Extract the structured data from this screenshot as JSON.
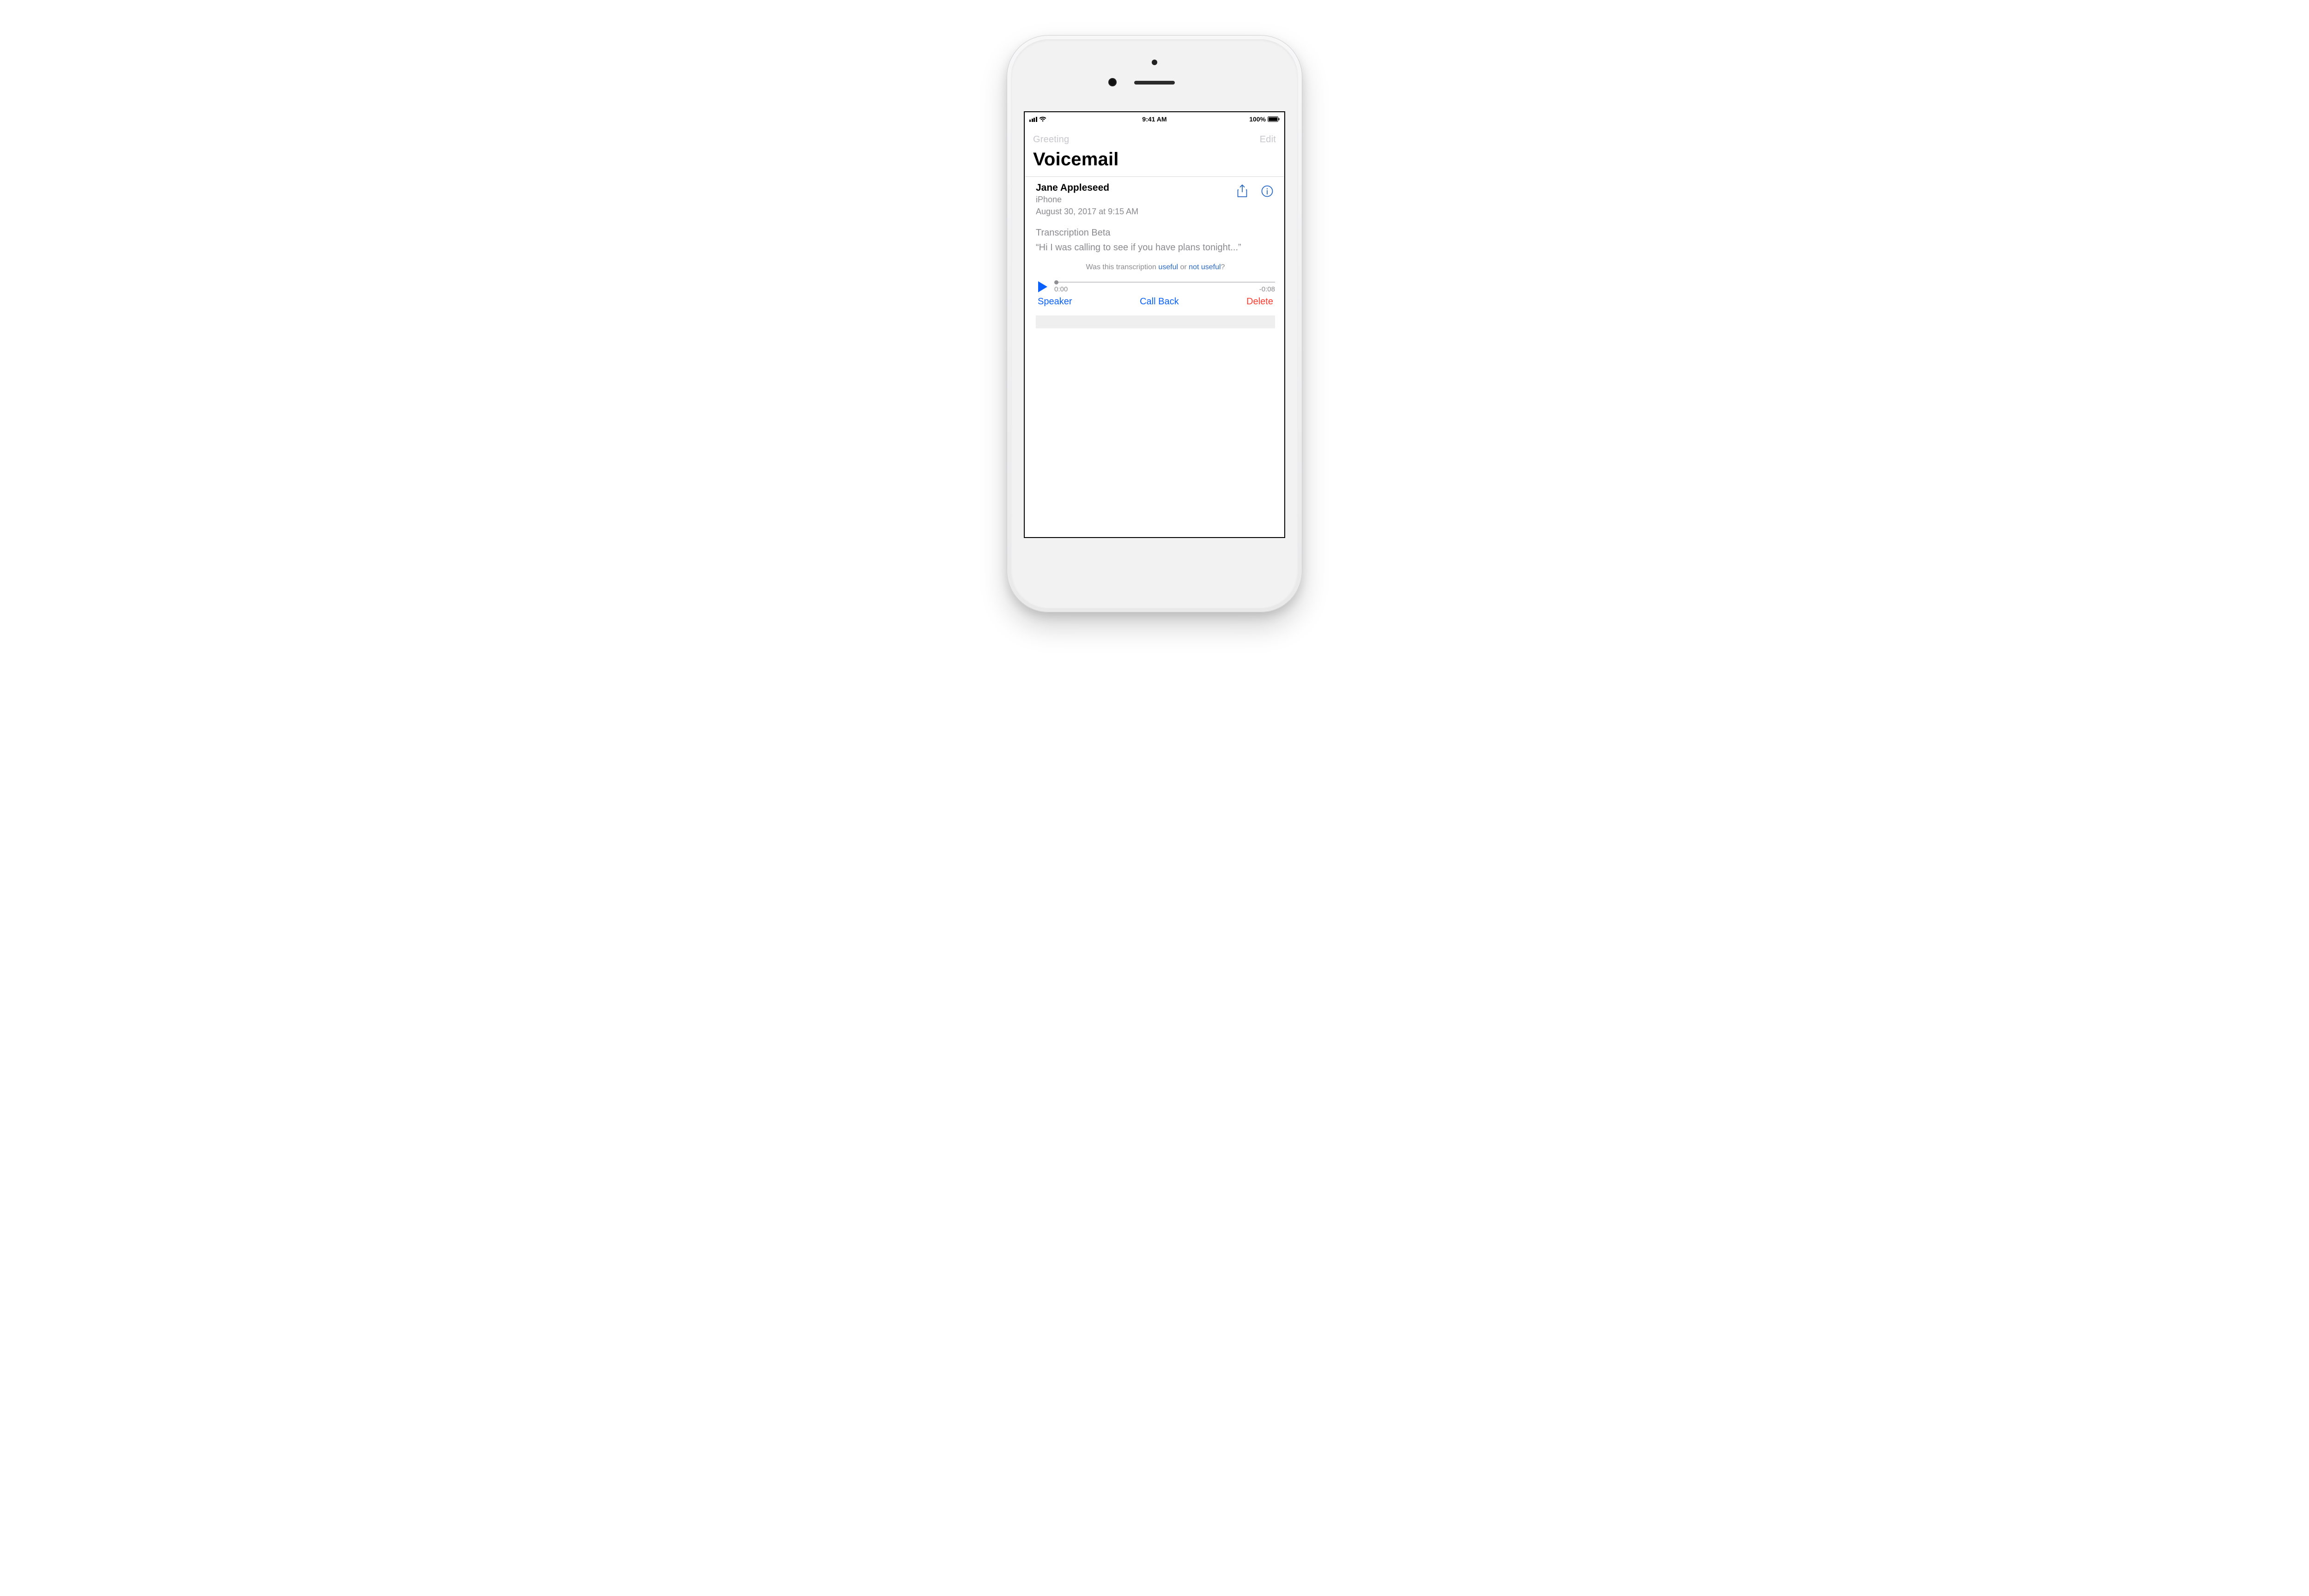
{
  "status": {
    "time": "9:41 AM",
    "battery": "100%"
  },
  "nav": {
    "greeting": "Greeting",
    "edit": "Edit"
  },
  "title": "Voicemail",
  "voicemail": {
    "caller": "Jane Appleseed",
    "source": "iPhone",
    "datetime": "August 30, 2017 at 9:15 AM",
    "transcription_label": "Transcription Beta",
    "transcription_text": "“Hi I was calling to see if you have plans tonight...”",
    "feedback_prefix": "Was this transcription ",
    "feedback_useful": "useful",
    "feedback_or": " or ",
    "feedback_not_useful": "not useful",
    "feedback_suffix": "?",
    "elapsed": "0:00",
    "remaining": "-0:08"
  },
  "actions": {
    "speaker": "Speaker",
    "call_back": "Call Back",
    "delete": "Delete"
  },
  "colors": {
    "ios_blue": "#0a60ff",
    "link_blue": "#2b68c4",
    "ios_red": "#ff3b30",
    "secondary": "#8a8a8f"
  }
}
